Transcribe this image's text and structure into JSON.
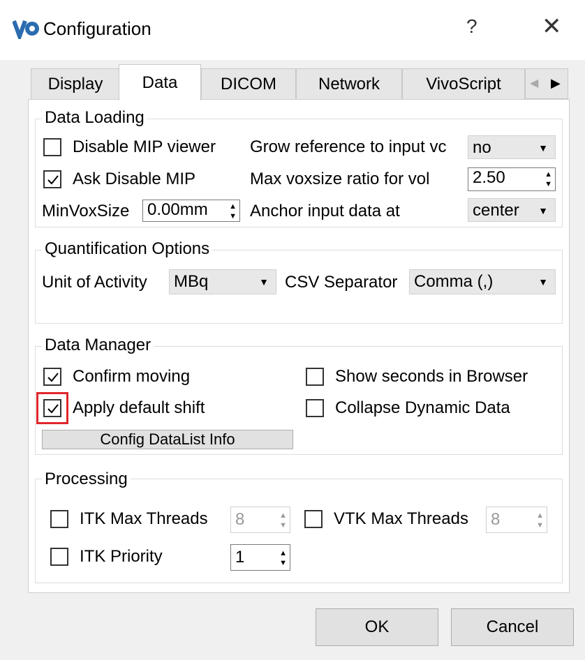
{
  "window": {
    "title": "Configuration",
    "help_label": "?",
    "close_label": "✕"
  },
  "tabs": [
    {
      "label": "Display",
      "active": false
    },
    {
      "label": "Data",
      "active": true
    },
    {
      "label": "DICOM",
      "active": false
    },
    {
      "label": "Network",
      "active": false
    },
    {
      "label": "VivoScript",
      "active": false
    }
  ],
  "tab_scroll": {
    "left_icon": "◀",
    "right_icon": "▶"
  },
  "data_loading": {
    "title": "Data Loading",
    "disable_mip": {
      "label": "Disable MIP viewer",
      "checked": false
    },
    "ask_disable_mip": {
      "label": "Ask Disable MIP",
      "checked": true
    },
    "min_vox_label": "MinVoxSize",
    "min_vox_value": "0.00mm",
    "grow_label": "Grow reference to input vc",
    "grow_value": "no",
    "max_vox_label": "Max voxsize ratio for vol",
    "max_vox_value": "2.50",
    "anchor_label": "Anchor input data at",
    "anchor_value": "center"
  },
  "quantification": {
    "title": "Quantification Options",
    "unit_label": "Unit of Activity",
    "unit_value": "MBq",
    "csv_label": "CSV Separator",
    "csv_value": "Comma (,)"
  },
  "data_manager": {
    "title": "Data Manager",
    "confirm_moving": {
      "label": "Confirm moving",
      "checked": true
    },
    "apply_shift": {
      "label": "Apply default shift",
      "checked": true
    },
    "show_seconds": {
      "label": "Show seconds in Browser",
      "checked": false
    },
    "collapse_dynamic": {
      "label": "Collapse Dynamic Data",
      "checked": false
    },
    "config_button": "Config DataList Info"
  },
  "processing": {
    "title": "Processing",
    "itk_threads": {
      "label": "ITK Max Threads",
      "checked": false,
      "value": "8"
    },
    "vtk_threads": {
      "label": "VTK Max Threads",
      "checked": false,
      "value": "8"
    },
    "itk_priority": {
      "label": "ITK Priority",
      "checked": false,
      "value": "1"
    }
  },
  "footer": {
    "ok": "OK",
    "cancel": "Cancel"
  },
  "colors": {
    "highlight": "#e0262b",
    "logo": "#2b6cb0"
  }
}
